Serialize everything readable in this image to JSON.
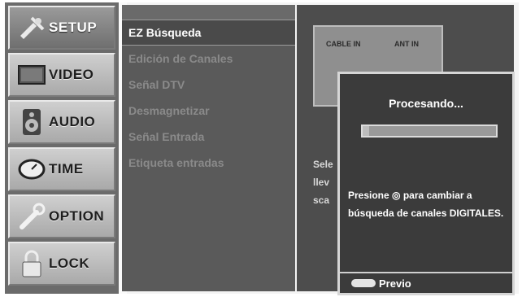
{
  "tabs": [
    {
      "label": "SETUP",
      "icon": "satellite-icon",
      "active": true
    },
    {
      "label": "VIDEO",
      "icon": "tv-screen-icon",
      "active": false
    },
    {
      "label": "AUDIO",
      "icon": "speaker-icon",
      "active": false
    },
    {
      "label": "TIME",
      "icon": "clock-icon",
      "active": false
    },
    {
      "label": "OPTION",
      "icon": "wrench-icon",
      "active": false
    },
    {
      "label": "LOCK",
      "icon": "padlock-icon",
      "active": false
    }
  ],
  "menu": {
    "items": [
      {
        "label": "EZ Búsqueda",
        "selected": true
      },
      {
        "label": "Edición de Canales",
        "selected": false
      },
      {
        "label": "Señal DTV",
        "selected": false
      },
      {
        "label": "Desmagnetizar",
        "selected": false
      },
      {
        "label": "Señal Entrada",
        "selected": false
      },
      {
        "label": "Etiqueta entradas",
        "selected": false
      }
    ]
  },
  "diagram": {
    "cable_label": "CABLE IN",
    "ant_label": "ANT IN"
  },
  "description": {
    "lines": [
      "Sele",
      "llev",
      "sca"
    ]
  },
  "dialog": {
    "title": "Procesando...",
    "progress": 0.05,
    "message": "Presione ◎ para cambiar a búsqueda de canales DIGITALES.",
    "footer_label": "Previo"
  },
  "colors": {
    "panel": "#5a5a5a",
    "dialog": "#3b3b3b",
    "selected": "#4a4a4a"
  }
}
